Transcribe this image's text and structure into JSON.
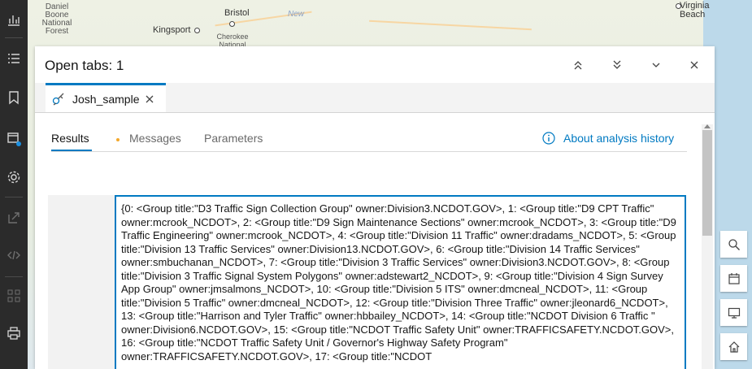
{
  "leftbar": {
    "items": [
      {
        "icon": "chart-icon"
      },
      {
        "icon": "list-icon"
      },
      {
        "icon": "bookmark-icon"
      },
      {
        "icon": "analysis-history-icon"
      },
      {
        "icon": "settings-icon"
      },
      {
        "icon": "share-icon"
      },
      {
        "icon": "code-icon"
      },
      {
        "icon": "apps-icon"
      },
      {
        "icon": "print-icon"
      }
    ]
  },
  "map": {
    "labels": {
      "forest": "Daniel Boone\nNational\nForest",
      "bristol": "Bristol",
      "kingsport": "Kingsport",
      "cherokee": "Cherokee\nNational",
      "new": "New",
      "virginia_beach": "Virginia\nBeach"
    }
  },
  "panel": {
    "title": "Open tabs: 1",
    "document_tab": {
      "label": "Josh_sample",
      "icon": "analysis-tool-icon"
    },
    "subtabs": [
      {
        "label": "Results",
        "active": true
      },
      {
        "label": "Messages",
        "active": false,
        "badge_color": "#f3a82b"
      },
      {
        "label": "Parameters",
        "active": false
      }
    ],
    "about_link": "About analysis history",
    "result_text": "{0: <Group title:\"D3 Traffic Sign Collection Group\" owner:Division3.NCDOT.GOV>, 1: <Group title:\"D9 CPT Traffic\" owner:mcrook_NCDOT>, 2: <Group title:\"D9 Sign Maintenance Sections\" owner:mcrook_NCDOT>, 3: <Group title:\"D9 Traffic Engineering\" owner:mcrook_NCDOT>, 4: <Group title:\"Division 11 Traffic\" owner:dradams_NCDOT>, 5: <Group title:\"Division 13 Traffic Services\" owner:Division13.NCDOT.GOV>, 6: <Group title:\"Division 14 Traffic Services\" owner:smbuchanan_NCDOT>, 7: <Group title:\"Division 3 Traffic Services\" owner:Division3.NCDOT.GOV>, 8: <Group title:\"Division 3 Traffic Signal System Polygons\" owner:adstewart2_NCDOT>, 9: <Group title:\"Division 4 Sign Survey App Group\" owner:jmsalmons_NCDOT>, 10: <Group title:\"Division 5 ITS\" owner:dmcneal_NCDOT>, 11: <Group title:\"Division 5 Traffic\" owner:dmcneal_NCDOT>, 12: <Group title:\"Division Three Traffic\" owner:jleonard6_NCDOT>, 13: <Group title:\"Harrison and Tyler Traffic\" owner:hbbailey_NCDOT>, 14: <Group title:\"NCDOT Division 6 Traffic \" owner:Division6.NCDOT.GOV>, 15: <Group title:\"NCDOT Traffic Safety Unit\" owner:TRAFFICSAFETY.NCDOT.GOV>, 16: <Group title:\"NCDOT Traffic Safety Unit / Governor's Highway Safety Program\" owner:TRAFFICSAFETY.NCDOT.GOV>, 17: <Group title:\"NCDOT"
  },
  "header_buttons": [
    {
      "icon": "chevrons-up-icon"
    },
    {
      "icon": "chevrons-down-icon"
    },
    {
      "icon": "chevron-down-icon"
    },
    {
      "icon": "close-icon"
    }
  ],
  "map_tools": [
    {
      "icon": "search-icon"
    },
    {
      "icon": "layers-icon"
    },
    {
      "icon": "monitor-icon"
    },
    {
      "icon": "home-icon"
    }
  ],
  "colors": {
    "accent": "#007ac2",
    "warning": "#f3a82b",
    "toolbar_bg": "#2b2b2b"
  }
}
